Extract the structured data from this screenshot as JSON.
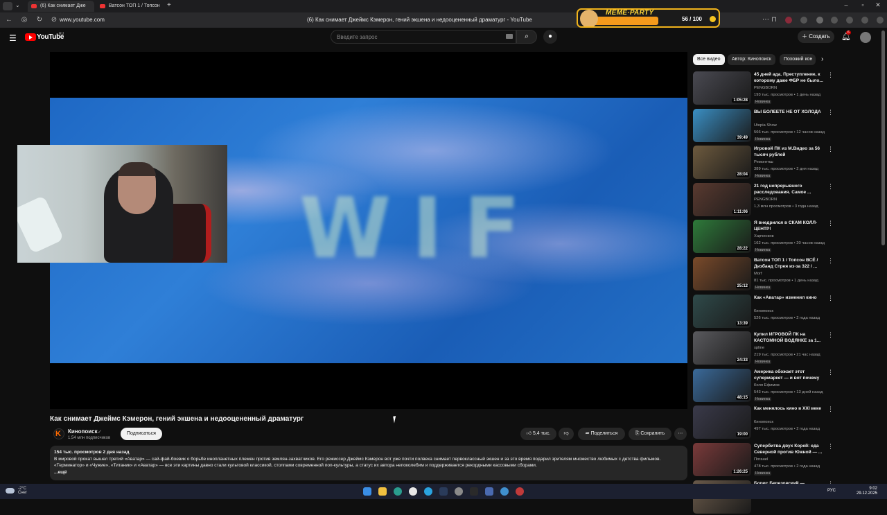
{
  "browser": {
    "tabs": [
      {
        "label": "(6) Как снимает Дже"
      },
      {
        "label": "Ватсон ТОП 1 / Топсон"
      }
    ],
    "url": "www.youtube.com",
    "page_title": "(6) Как снимает Джеймс Кэмерон, гений экшена и недооцененный драматург - YouTube"
  },
  "meme_party": {
    "title": "MEME·PARTY",
    "score": "56 / 100",
    "progress": 0.56
  },
  "header": {
    "logo_text": "YouTube",
    "region": "RU",
    "search_placeholder": "Введите запрос",
    "create_label": "Создать",
    "notifications": "6"
  },
  "player": {
    "frame_text": "WIF"
  },
  "video": {
    "title": "Как снимает Джеймс Кэмерон, гений экшена и недооцененный драматург",
    "channel": "Кинопоиск",
    "channel_logo": "K",
    "subscribers": "1,54 млн подписчиков",
    "subscribe_label": "Подписаться",
    "likes": "5,4 тыс.",
    "share_label": "Поделиться",
    "save_label": "Сохранить",
    "stats": "154 тыс. просмотров  2 дня назад",
    "description": "В мировой прокат вышел третий «Аватар» — сай-фай-боевик о борьбе инопланетных племен против землян-захватчиков. Его режиссер Джеймс Кэмерон вот уже почти полвека снимает первоклассный экшен и за это время подарил зрителям множество любимых с детства фильмов. «Терминатор» и «Чужие», «Титаник» и «Аватар» — все эти картины давно стали культовой классикой, столпами современной поп-культуры, а статус их автора непоколебим и поддерживается рекордными кассовыми сборами.",
    "more_label": "...ещё"
  },
  "sidebar": {
    "chips": [
      "Все видео",
      "Автор: Кинопоиск",
      "Похожий кон"
    ],
    "recommendations": [
      {
        "title": "45 дней ада. Преступление, к которому даже ФБР не было...",
        "channel": "PENGBORN",
        "views": "193 тыс. просмотров • 1 день назад",
        "badge": "Новинка",
        "duration": "1:05:28",
        "color": "#4a4a52"
      },
      {
        "title": "ВЫ БОЛЕЕТЕ НЕ ОТ ХОЛОДА",
        "channel": "Utopia Show",
        "views": "566 тыс. просмотров • 12 часов назад",
        "badge": "Новинка",
        "duration": "39:49",
        "color": "#3a8fc4"
      },
      {
        "title": "Игровой ПК из М.Видео за 56 тысяч рублей",
        "channel": "Ремонтяш",
        "views": "389 тыс. просмотров • 2 дня назад",
        "badge": "Новинка",
        "duration": "28:04",
        "color": "#6d5a3e"
      },
      {
        "title": "21 год непрерывного расследования. Самое ...",
        "channel": "PENGBORN",
        "views": "1,3 млн просмотров • 3 года назад",
        "badge": "",
        "duration": "1:11:06",
        "color": "#5a3a30"
      },
      {
        "title": "Я внедрился в СКАМ КОЛЛ-ЦЕНТР!",
        "channel": "Харченков",
        "views": "162 тыс. просмотров • 20 часов назад",
        "badge": "Новинка",
        "duration": "28:22",
        "color": "#2e7a3a"
      },
      {
        "title": "Ватсон ТОП 1 / Топсон ВСЁ / Дизбанд Стрея из-за 322 / ...",
        "channel": "Morf",
        "views": "81 тыс. просмотров • 1 день назад",
        "badge": "Новинка",
        "duration": "25:12",
        "color": "#7a4a2a"
      },
      {
        "title": "Как «Аватар» изменил кино",
        "channel": "Кинопоиск",
        "views": "526 тыс. просмотров • 2 года назад",
        "badge": "",
        "duration": "13:39",
        "color": "#2f4a4a"
      },
      {
        "title": "Купил ИГРОВОЙ ПК на КАСТОМНОЙ ВОДЯНКЕ за 1...",
        "channel": "spline",
        "views": "219 тыс. просмотров • 21 час назад",
        "badge": "Новинка",
        "duration": "24:33",
        "color": "#5a5a5e"
      },
      {
        "title": "Америка обожает этот супермаркет — и вот почему",
        "channel": "Коля Ефимов",
        "views": "543 тыс. просмотров • 13 дней назад",
        "badge": "Новинка",
        "duration": "48:15",
        "color": "#3a6a9a"
      },
      {
        "title": "Как менялось кино в XXI веке",
        "channel": "Кинопоиск",
        "views": "497 тыс. просмотров • 2 года назад",
        "badge": "",
        "duration": "19:00",
        "color": "#3a3a4a"
      },
      {
        "title": "Супербитва двух Корей: еда Северной против Южной — ...",
        "channel": "Поганеl",
        "views": "478 тыс. просмотров • 2 года назад",
        "badge": "Новинка",
        "duration": "1:26:25",
        "color": "#7a3a3a"
      },
      {
        "title": "Борис Березовский —",
        "channel": "",
        "views": "",
        "badge": "",
        "duration": "",
        "color": "#6a5a4a"
      }
    ]
  },
  "taskbar": {
    "weather_temp": "-2°C",
    "weather_text": "Снег",
    "lang": "РУС",
    "time": "9:02",
    "date": "29.12.2025"
  }
}
